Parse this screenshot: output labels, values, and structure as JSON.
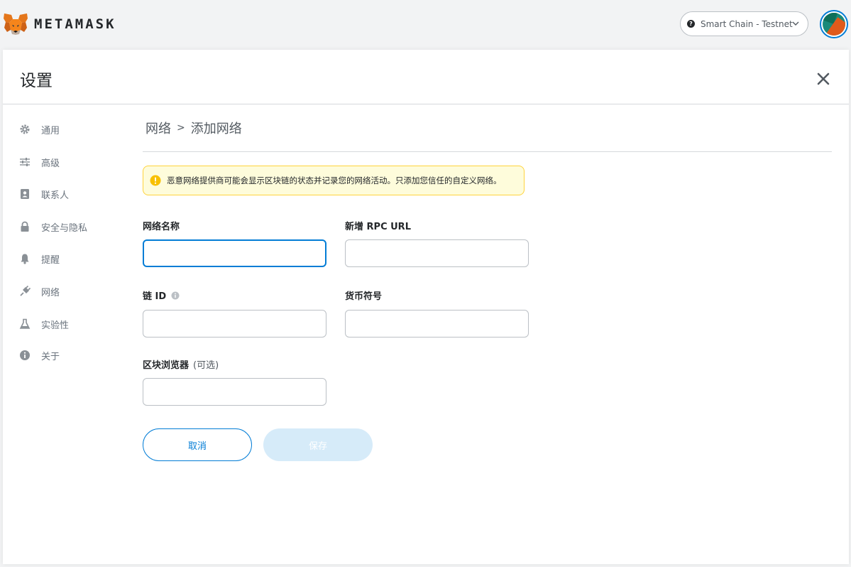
{
  "header": {
    "brand": "METAMASK",
    "network_label": "Smart Chain - Testnet",
    "network_dot": "?"
  },
  "settings": {
    "title": "设置"
  },
  "sidebar": {
    "items": [
      {
        "label": "通用",
        "icon": "gear-icon"
      },
      {
        "label": "高级",
        "icon": "sliders-icon"
      },
      {
        "label": "联系人",
        "icon": "contact-book-icon"
      },
      {
        "label": "安全与隐私",
        "icon": "lock-icon"
      },
      {
        "label": "提醒",
        "icon": "bell-icon"
      },
      {
        "label": "网络",
        "icon": "plug-icon"
      },
      {
        "label": "实验性",
        "icon": "flask-icon"
      },
      {
        "label": "关于",
        "icon": "info-icon"
      }
    ]
  },
  "breadcrumb": {
    "parent": "网络",
    "separator": ">",
    "current": "添加网络"
  },
  "warning": {
    "text": "恶意网络提供商可能会显示区块链的状态并记录您的网络活动。只添加您信任的自定义网络。"
  },
  "form": {
    "network_name": {
      "label": "网络名称",
      "value": "",
      "placeholder": ""
    },
    "rpc_url": {
      "label": "新增 RPC URL",
      "value": "",
      "placeholder": ""
    },
    "chain_id": {
      "label": "链 ID",
      "value": "",
      "placeholder": ""
    },
    "currency_symbol": {
      "label": "货币符号",
      "value": "",
      "placeholder": ""
    },
    "block_explorer": {
      "label": "区块浏览器",
      "optional": "(可选)",
      "value": "",
      "placeholder": ""
    }
  },
  "buttons": {
    "cancel": "取消",
    "save": "保存"
  },
  "colors": {
    "accent": "#037dd6",
    "warning_bg": "#fefcdb",
    "warning_border": "#ffd33d",
    "disabled_button": "#d6ebf9"
  }
}
